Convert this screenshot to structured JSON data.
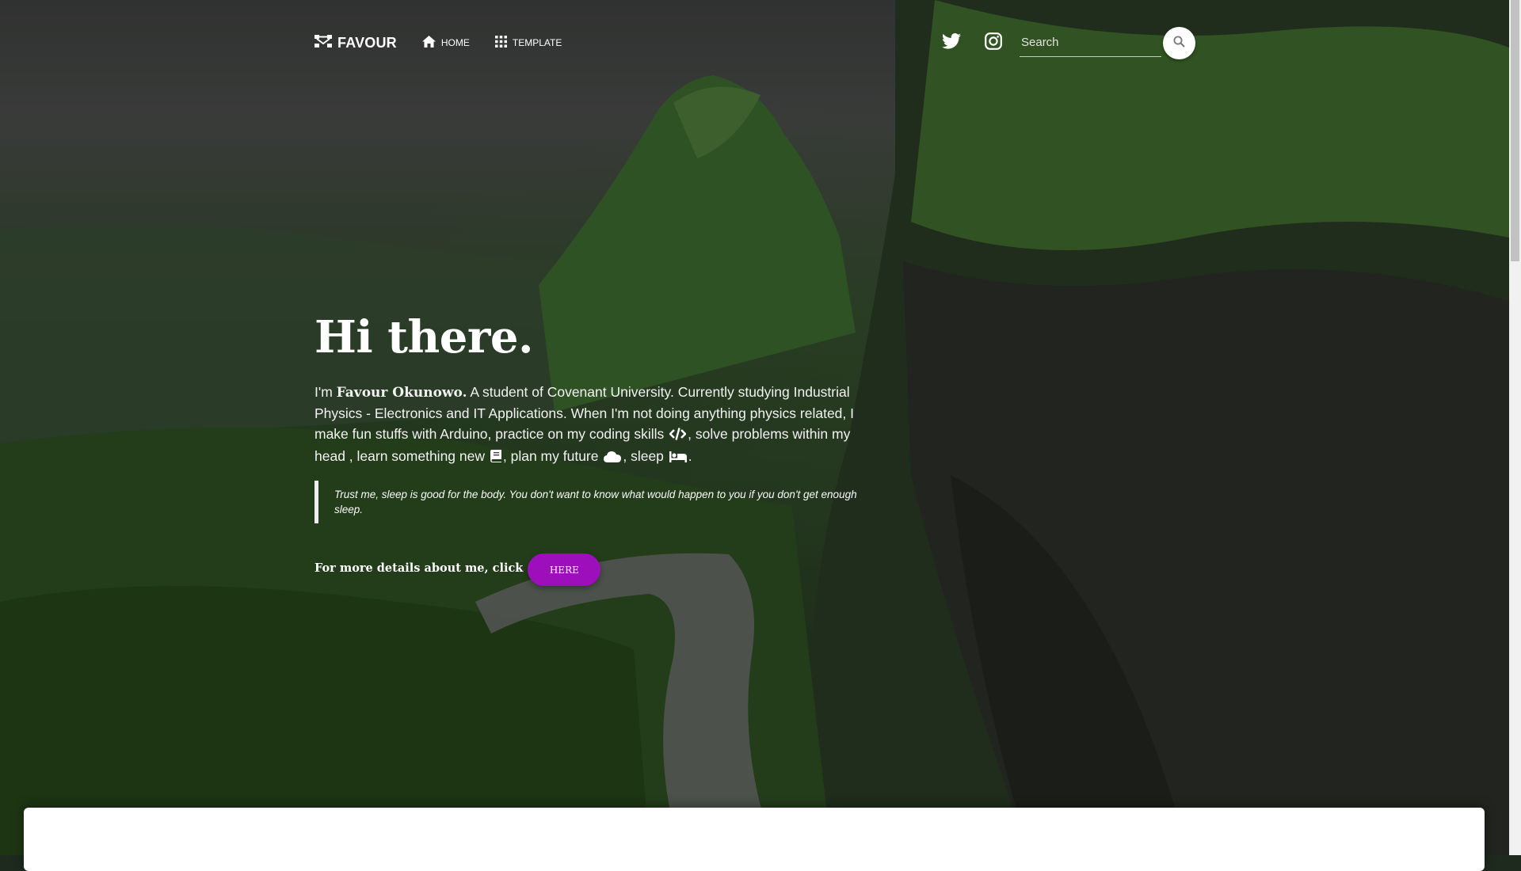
{
  "navbar": {
    "brand": "FAVOUR",
    "links": [
      {
        "label": "HOME",
        "icon": "home-icon"
      },
      {
        "label": "TEMPLATE",
        "icon": "apps-grid-icon"
      }
    ],
    "social": [
      "twitter-icon",
      "instagram-icon"
    ],
    "search": {
      "placeholder": "Search",
      "value": ""
    }
  },
  "hero": {
    "title": "Hi there.",
    "intro": {
      "prefix": "I'm ",
      "name": "Favour Okunowo.",
      "body1": " A student of Covenant University. Currently studying Industrial Physics - Electronics and IT Applications. When I'm not doing anything physics related, I make fun stuffs with Arduino, practice on my coding skills ",
      "body2": ", solve problems within my head , learn something new ",
      "body3": ", plan my future ",
      "body4": ", sleep ",
      "body5": "."
    },
    "quote": "Trust me, sleep is good for the body. You don't want to know what would happen to you if you don't get enough sleep.",
    "more_text": "For more details about me, click",
    "button_label": "HERE"
  },
  "colors": {
    "accent": "#9c0fba",
    "quote_border": "#eeeeee"
  }
}
